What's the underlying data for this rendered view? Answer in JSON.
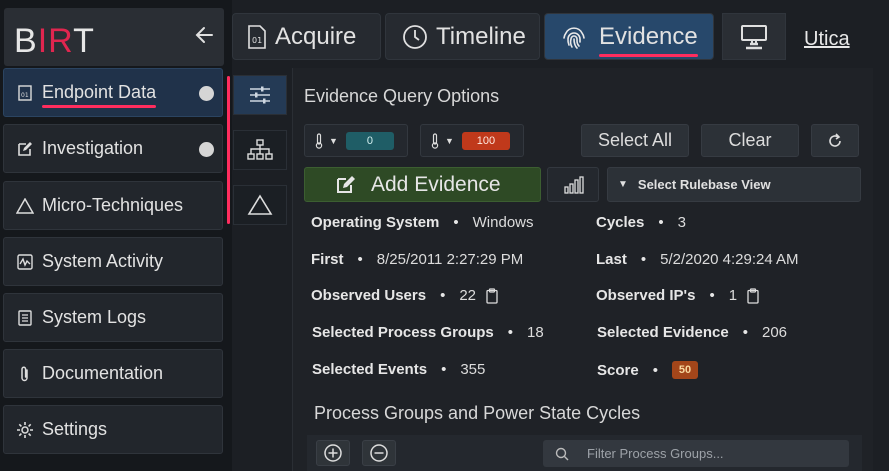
{
  "brand": {
    "prefix": "B",
    "accent": "IR",
    "suffix": "T"
  },
  "sidebar": {
    "items": [
      {
        "label": "Endpoint Data",
        "icon": "binary-file-icon"
      },
      {
        "label": "Investigation",
        "icon": "edit-icon"
      },
      {
        "label": "Micro-Techniques",
        "icon": "triangle-icon"
      },
      {
        "label": "System Activity",
        "icon": "activity-monitor-icon"
      },
      {
        "label": "System Logs",
        "icon": "document-icon"
      },
      {
        "label": "Documentation",
        "icon": "paperclip-icon"
      },
      {
        "label": "Settings",
        "icon": "gear-icon"
      }
    ]
  },
  "tabs": [
    {
      "label": "Acquire",
      "icon": "binary-file-icon"
    },
    {
      "label": "Timeline",
      "icon": "clock-icon"
    },
    {
      "label": "Evidence",
      "icon": "fingerprint-icon",
      "active": true
    }
  ],
  "host": {
    "name": "Utica",
    "icon": "computer-icon"
  },
  "panel": {
    "title": "Evidence Query Options",
    "thermo_low": "0",
    "thermo_high": "100",
    "select_all": "Select All",
    "clear": "Clear",
    "add_evidence": "Add Evidence",
    "rulebase": "Select Rulebase View"
  },
  "info": {
    "os_label": "Operating System",
    "os_value": "Windows",
    "cycles_label": "Cycles",
    "cycles_value": "3",
    "first_label": "First",
    "first_value": "8/25/2011 2:27:29 PM",
    "last_label": "Last",
    "last_value": "5/2/2020 4:29:24 AM",
    "users_label": "Observed Users",
    "users_value": "22",
    "ips_label": "Observed IP's",
    "ips_value": "1",
    "pgroups_label": "Selected Process Groups",
    "pgroups_value": "18",
    "evidence_label": "Selected Evidence",
    "evidence_value": "206",
    "events_label": "Selected Events",
    "events_value": "355",
    "score_label": "Score",
    "score_value": "50"
  },
  "section": {
    "title": "Process Groups and Power State Cycles"
  },
  "filter": {
    "placeholder": "Filter Process Groups..."
  },
  "colors": {
    "accent": "#ff2d5e",
    "active_tab": "#27486b",
    "add_btn": "#2e4a25",
    "score": "#a3461a"
  }
}
